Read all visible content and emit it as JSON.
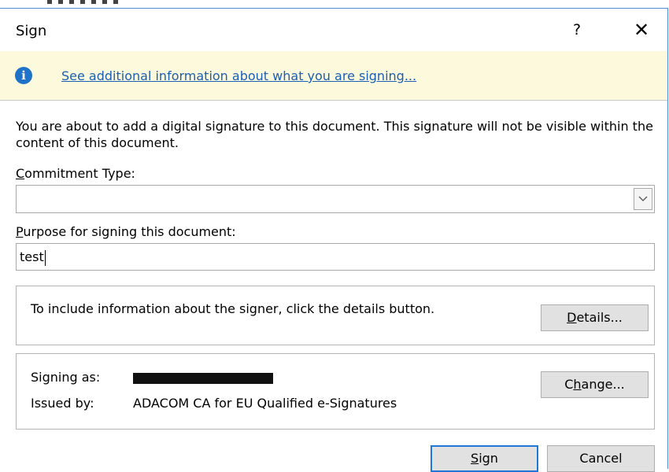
{
  "dialog": {
    "title": "Sign",
    "help_label": "?",
    "close_label": "✕"
  },
  "infobar": {
    "link_text": "See additional information about what you are signing..."
  },
  "form": {
    "description": "You are about to add a digital signature to this document. This signature will not be visible within the content of this document.",
    "commitment_label_key": "C",
    "commitment_label_rest": "ommitment Type:",
    "commitment_value": "",
    "purpose_label_key": "P",
    "purpose_label_rest": "urpose for signing this document:",
    "purpose_value": "test"
  },
  "details_group": {
    "text": "To include information about the signer, click the details button.",
    "button_key": "D",
    "button_rest": "etails..."
  },
  "signer_group": {
    "signing_as_label": "Signing as:",
    "issued_by_label": "Issued by:",
    "issued_by_value": "ADACOM CA for EU Qualified e-Signatures",
    "change_button_pre": "C",
    "change_button_key": "h",
    "change_button_rest": "ange..."
  },
  "footer": {
    "sign_button_key": "S",
    "sign_button_rest": "ign",
    "cancel_label": "Cancel"
  },
  "colors": {
    "infobar_bg": "#fcf9dc",
    "link": "#1a5fb4",
    "accent": "#2277d6"
  },
  "icons": {
    "info": "info-icon",
    "dropdown": "chevron-down-icon",
    "close": "close-icon"
  }
}
